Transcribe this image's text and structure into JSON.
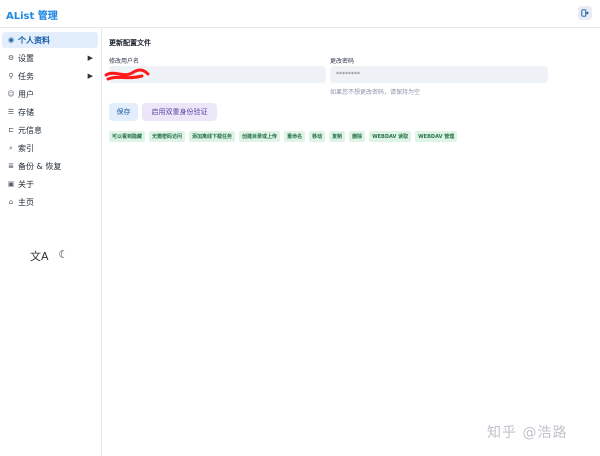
{
  "app": {
    "title": "AList 管理"
  },
  "sidebar": {
    "items": [
      {
        "label": "个人资料",
        "icon": "user-circle-icon",
        "active": true
      },
      {
        "label": "设置",
        "icon": "gear-icon",
        "has_children": true
      },
      {
        "label": "任务",
        "icon": "tasks-icon",
        "has_children": true
      },
      {
        "label": "用户",
        "icon": "user-icon"
      },
      {
        "label": "存储",
        "icon": "storage-icon"
      },
      {
        "label": "元信息",
        "icon": "meta-icon"
      },
      {
        "label": "索引",
        "icon": "search-icon"
      },
      {
        "label": "备份 & 恢复",
        "icon": "database-icon"
      },
      {
        "label": "关于",
        "icon": "info-icon"
      },
      {
        "label": "主页",
        "icon": "home-icon"
      }
    ],
    "tools": {
      "translate": "translate-icon",
      "theme": "moon-icon"
    }
  },
  "main": {
    "section_title": "更新配置文件",
    "username": {
      "label": "修改用户名",
      "value": ""
    },
    "password": {
      "label": "更改密码",
      "placeholder": "********",
      "hint": "如果您不想更改密码，请保持为空"
    },
    "save_label": "保存",
    "two_factor_label": "启用双重身份验证",
    "permissions": [
      "可以看到隐藏",
      "无需密码访问",
      "添加离线下载任务",
      "创建目录或上传",
      "重命名",
      "移动",
      "复制",
      "删除",
      "WEBDAV 读取",
      "WEBDAV 管理"
    ]
  },
  "watermark": "知乎 @浩路",
  "colors": {
    "accent": "#1e88e5",
    "active_bg": "#e3eefc",
    "tag_bg": "#dff4e6",
    "tag_text": "#27734a",
    "redaction": "#ff1a1a"
  }
}
